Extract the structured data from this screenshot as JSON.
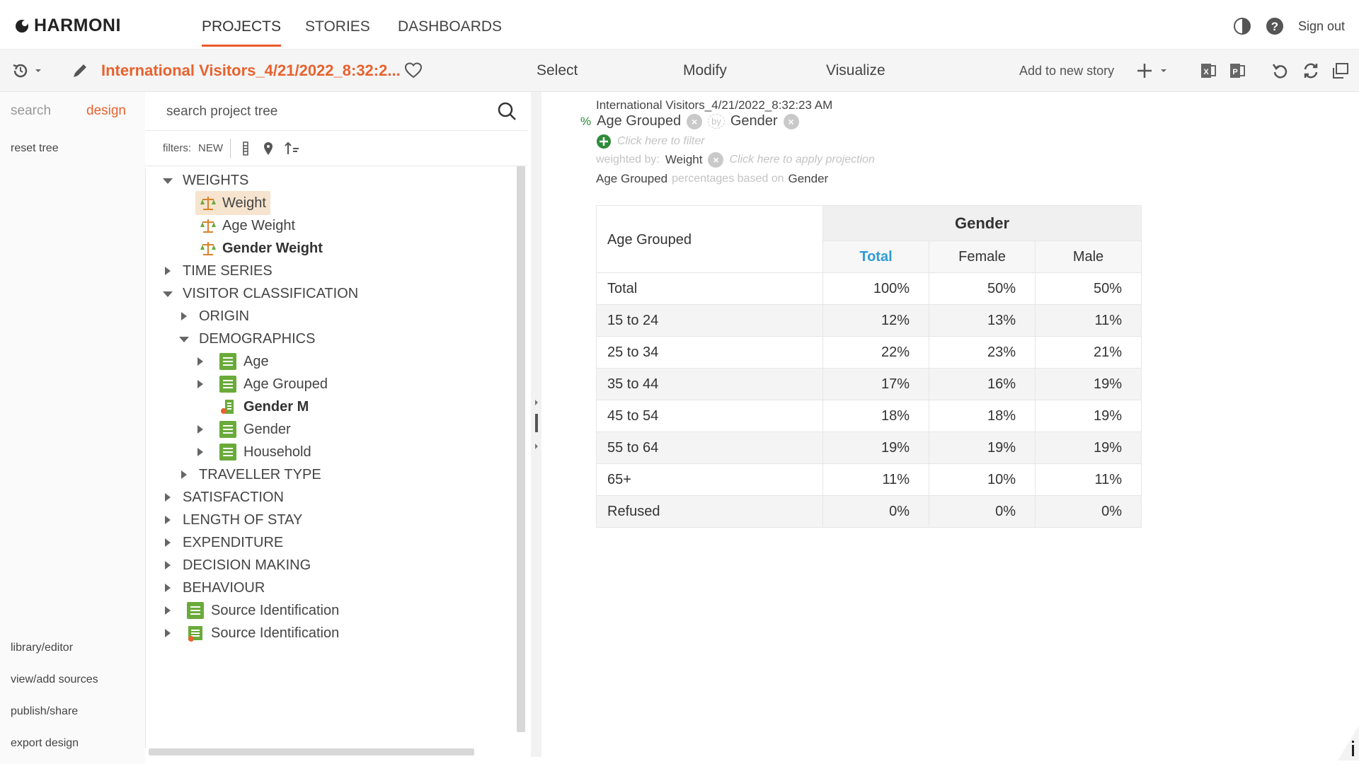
{
  "brand": {
    "name": "HARMONI"
  },
  "nav": {
    "tabs": [
      "PROJECTS",
      "STORIES",
      "DASHBOARDS"
    ],
    "sign_out": "Sign out"
  },
  "toolbar": {
    "project_title": "International Visitors_4/21/2022_8:32:2...",
    "modes": [
      "Select",
      "Modify",
      "Visualize"
    ],
    "add_to_story": "Add to new story"
  },
  "left": {
    "tabs": [
      "search",
      "design"
    ],
    "reset_tree": "reset tree",
    "links": [
      "library/editor",
      "view/add sources",
      "publish/share",
      "export design"
    ]
  },
  "tree_panel": {
    "search_placeholder": "search project tree",
    "filters_label": "filters:",
    "filters_new": "NEW",
    "nodes": [
      "WEIGHTS",
      "Weight",
      "Age Weight",
      "Gender Weight",
      "TIME SERIES",
      "VISITOR CLASSIFICATION",
      "ORIGIN",
      "DEMOGRAPHICS",
      "Age",
      "Age Grouped",
      "Gender M",
      "Gender",
      "Household",
      "TRAVELLER TYPE",
      "SATISFACTION",
      "LENGTH OF STAY",
      "EXPENDITURE",
      "DECISION MAKING",
      "BEHAVIOUR",
      "Source Identification",
      "Source Identification"
    ]
  },
  "table_spec": {
    "title": "International Visitors_4/21/2022_8:32:23 AM",
    "percent_sign": "%",
    "row_var": "Age Grouped",
    "by_label": "by",
    "col_var": "Gender",
    "filter_hint": "Click here to filter",
    "weighted_by_label": "weighted by:",
    "weight_var": "Weight",
    "projection_hint": "Click here to apply projection",
    "pct_note_prefix": "Age Grouped",
    "pct_note_mid": "percentages based on",
    "pct_note_suffix": "Gender"
  },
  "crosstab": {
    "row_header": "Age Grouped",
    "col_group": "Gender",
    "columns": [
      "Total",
      "Female",
      "Male"
    ],
    "rows": [
      {
        "label": "Total",
        "values": [
          "100%",
          "50%",
          "50%"
        ]
      },
      {
        "label": "15 to 24",
        "values": [
          "12%",
          "13%",
          "11%"
        ]
      },
      {
        "label": "25 to 34",
        "values": [
          "22%",
          "23%",
          "21%"
        ]
      },
      {
        "label": "35 to 44",
        "values": [
          "17%",
          "16%",
          "19%"
        ]
      },
      {
        "label": "45 to 54",
        "values": [
          "18%",
          "18%",
          "19%"
        ]
      },
      {
        "label": "55 to 64",
        "values": [
          "19%",
          "19%",
          "19%"
        ]
      },
      {
        "label": "65+",
        "values": [
          "11%",
          "10%",
          "11%"
        ]
      },
      {
        "label": "Refused",
        "values": [
          "0%",
          "0%",
          "0%"
        ]
      }
    ]
  },
  "colors": {
    "accent": "#ea5a2a",
    "total_header": "#2e9bd6",
    "list_icon": "#6aaa3a"
  }
}
